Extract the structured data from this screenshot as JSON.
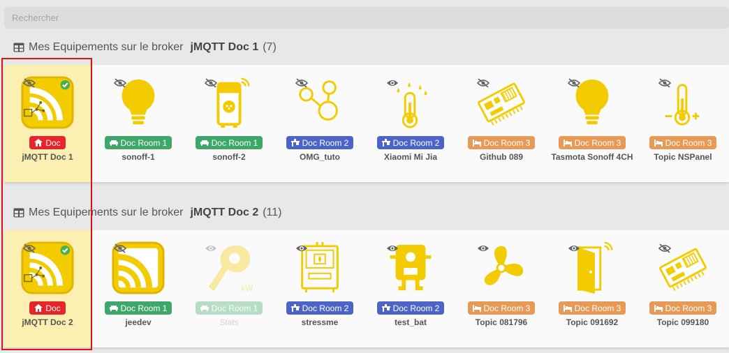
{
  "search": {
    "placeholder": "Rechercher"
  },
  "colors": {
    "accent_yellow": "#f2cc00",
    "doc_red": "#e8242a",
    "room1_green": "#3da86a",
    "room2_blue": "#4b64c6",
    "room3_orange": "#e79a55",
    "highlight_red": "#dd1111"
  },
  "sections": [
    {
      "prefix": "Mes Equipements sur le broker",
      "broker": "jMQTT Doc 1",
      "count": "(7)",
      "cards": [
        {
          "icon": "jmqtt-broker-icon",
          "visibility": "hidden-eye-icon",
          "badge": "Doc",
          "badge_icon": "home-icon",
          "name": "jMQTT Doc 1"
        },
        {
          "icon": "light-bulb-icon",
          "visibility": "hidden-eye-icon",
          "badge": "Doc Room 1",
          "badge_icon": "sofa-icon",
          "name": "sonoff-1"
        },
        {
          "icon": "smart-plug-icon",
          "visibility": "hidden-eye-icon",
          "badge": "Doc Room 1",
          "badge_icon": "sofa-icon",
          "name": "sonoff-2"
        },
        {
          "icon": "network-nodes-icon",
          "visibility": "hidden-eye-icon",
          "badge": "Doc Room 2",
          "badge_icon": "desk-icon",
          "name": "OMG_tuto"
        },
        {
          "icon": "thermometer-drops-icon",
          "visibility": "visible-eye-icon",
          "badge": "Doc Room 2",
          "badge_icon": "desk-icon",
          "name": "Xiaomi Mi Jia"
        },
        {
          "icon": "circuit-board-icon",
          "visibility": "hidden-eye-icon",
          "badge": "Doc Room 3",
          "badge_icon": "bed-icon",
          "name": "Github 089"
        },
        {
          "icon": "light-bulb-icon",
          "visibility": "hidden-eye-icon",
          "badge": "Doc Room 3",
          "badge_icon": "bed-icon",
          "name": "Tasmota Sonoff 4CH"
        },
        {
          "icon": "thermometer-plus-minus-icon",
          "visibility": "hidden-eye-icon",
          "badge": "Doc Room 3",
          "badge_icon": "bed-icon",
          "name": "Topic NSPanel"
        }
      ]
    },
    {
      "prefix": "Mes Equipements sur le broker",
      "broker": "jMQTT Doc 2",
      "count": "(11)",
      "cards": [
        {
          "icon": "jmqtt-broker-icon",
          "visibility": "hidden-eye-icon",
          "badge": "Doc",
          "badge_icon": "home-icon",
          "name": "jMQTT Doc 2"
        },
        {
          "icon": "jmqtt-device-icon",
          "visibility": "hidden-eye-icon",
          "badge": "Doc Room 1",
          "badge_icon": "sofa-icon",
          "name": "jeedev"
        },
        {
          "icon": "clamp-meter-icon",
          "visibility": "visible-eye-icon",
          "badge": "Doc Room 1",
          "badge_icon": "sofa-icon",
          "name": "Stats",
          "kw": "kW",
          "disabled": true
        },
        {
          "icon": "boiler-icon",
          "visibility": "visible-eye-icon",
          "badge": "Doc Room 2",
          "badge_icon": "desk-icon",
          "name": "stressme"
        },
        {
          "icon": "sensor-box-icon",
          "visibility": "visible-eye-icon",
          "badge": "Doc Room 2",
          "badge_icon": "desk-icon",
          "name": "test_bat"
        },
        {
          "icon": "fan-icon",
          "visibility": "visible-eye-icon",
          "badge": "Doc Room 3",
          "badge_icon": "bed-icon",
          "name": "Topic 081796"
        },
        {
          "icon": "door-sensor-icon",
          "visibility": "visible-eye-icon",
          "badge": "Doc Room 3",
          "badge_icon": "bed-icon",
          "name": "Topic 091692"
        },
        {
          "icon": "circuit-board-icon",
          "visibility": "hidden-eye-icon",
          "badge": "Doc Room 3",
          "badge_icon": "bed-icon",
          "name": "Topic 099180"
        }
      ]
    }
  ]
}
